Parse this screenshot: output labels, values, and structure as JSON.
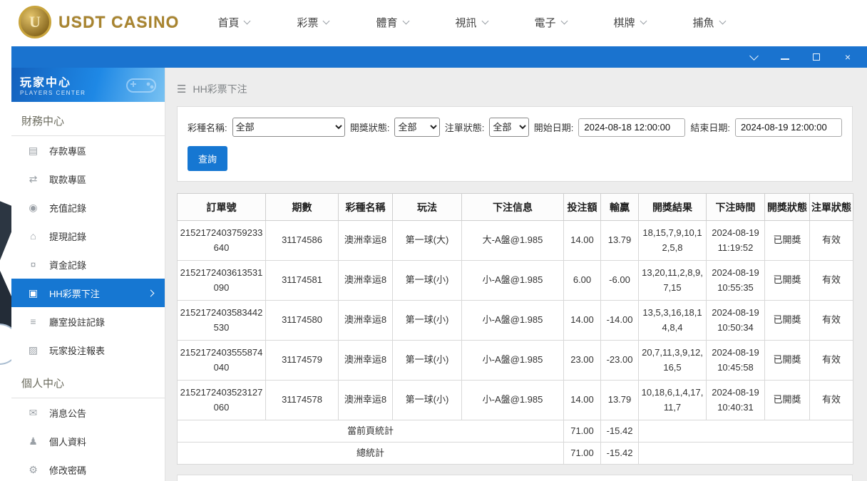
{
  "topnav": {
    "logo_badge_letter": "U",
    "logo_text": "USDT CASINO",
    "items": [
      {
        "label": "首頁"
      },
      {
        "label": "彩票"
      },
      {
        "label": "體育"
      },
      {
        "label": "視訊"
      },
      {
        "label": "電子"
      },
      {
        "label": "棋牌"
      },
      {
        "label": "捕魚"
      }
    ]
  },
  "icons": {
    "menu": "☰",
    "close": "×"
  },
  "sidebar": {
    "title": "玩家中心",
    "subtitle": "PLAYERS CENTER",
    "sections": [
      {
        "title": "財務中心",
        "items": [
          {
            "label": "存款專區",
            "icon": "▤"
          },
          {
            "label": "取款專區",
            "icon": "⇄"
          },
          {
            "label": "充值記錄",
            "icon": "◉"
          },
          {
            "label": "提現記錄",
            "icon": "⌂"
          },
          {
            "label": "資金記錄",
            "icon": "¤"
          },
          {
            "label": "HH彩票下注",
            "icon": "▣"
          },
          {
            "label": "廳室投註記錄",
            "icon": "≡"
          },
          {
            "label": "玩家投注報表",
            "icon": "▨"
          }
        ]
      },
      {
        "title": "個人中心",
        "items": [
          {
            "label": "消息公告",
            "icon": "✉"
          },
          {
            "label": "個人資料",
            "icon": "♟"
          },
          {
            "label": "修改密碼",
            "icon": "⚙"
          }
        ]
      }
    ]
  },
  "main": {
    "breadcrumb": "HH彩票下注",
    "filters": {
      "lottery_label": "彩種名稱:",
      "lottery_value": "全部",
      "draw_status_label": "開獎狀態:",
      "draw_status_value": "全部",
      "order_status_label": "注單狀態:",
      "order_status_value": "全部",
      "start_label": "開始日期:",
      "start_value": "2024-08-18 12:00:00",
      "end_label": "結束日期:",
      "end_value": "2024-08-19 12:00:00",
      "search_button": "查詢"
    },
    "table": {
      "headers": [
        "訂單號",
        "期數",
        "彩種名稱",
        "玩法",
        "下注信息",
        "投注額",
        "輸贏",
        "開獎結果",
        "下注時間",
        "開獎狀態",
        "注單狀態"
      ],
      "rows": [
        [
          "2152172403759233640",
          "31174586",
          "澳洲幸运8",
          "第一球(大)",
          "大-A盤@1.985",
          "14.00",
          "13.79",
          "18,15,7,9,10,12,5,8",
          "2024-08-19 11:19:52",
          "已開獎",
          "有效"
        ],
        [
          "2152172403613531090",
          "31174581",
          "澳洲幸运8",
          "第一球(小)",
          "小-A盤@1.985",
          "6.00",
          "-6.00",
          "13,20,11,2,8,9,7,15",
          "2024-08-19 10:55:35",
          "已開獎",
          "有效"
        ],
        [
          "2152172403583442530",
          "31174580",
          "澳洲幸运8",
          "第一球(小)",
          "小-A盤@1.985",
          "14.00",
          "-14.00",
          "13,5,3,16,18,14,8,4",
          "2024-08-19 10:50:34",
          "已開獎",
          "有效"
        ],
        [
          "2152172403555874040",
          "31174579",
          "澳洲幸运8",
          "第一球(小)",
          "小-A盤@1.985",
          "23.00",
          "-23.00",
          "20,7,11,3,9,12,16,5",
          "2024-08-19 10:45:58",
          "已開獎",
          "有效"
        ],
        [
          "2152172403523127060",
          "31174578",
          "澳洲幸运8",
          "第一球(小)",
          "小-A盤@1.985",
          "14.00",
          "13.79",
          "10,18,6,1,4,17,11,7",
          "2024-08-19 10:40:31",
          "已開獎",
          "有效"
        ]
      ],
      "summary": [
        {
          "label": "當前頁統計",
          "bet_total": "71.00",
          "winloss_total": "-15.42"
        },
        {
          "label": "總統計",
          "bet_total": "71.00",
          "winloss_total": "-15.42"
        }
      ]
    }
  }
}
